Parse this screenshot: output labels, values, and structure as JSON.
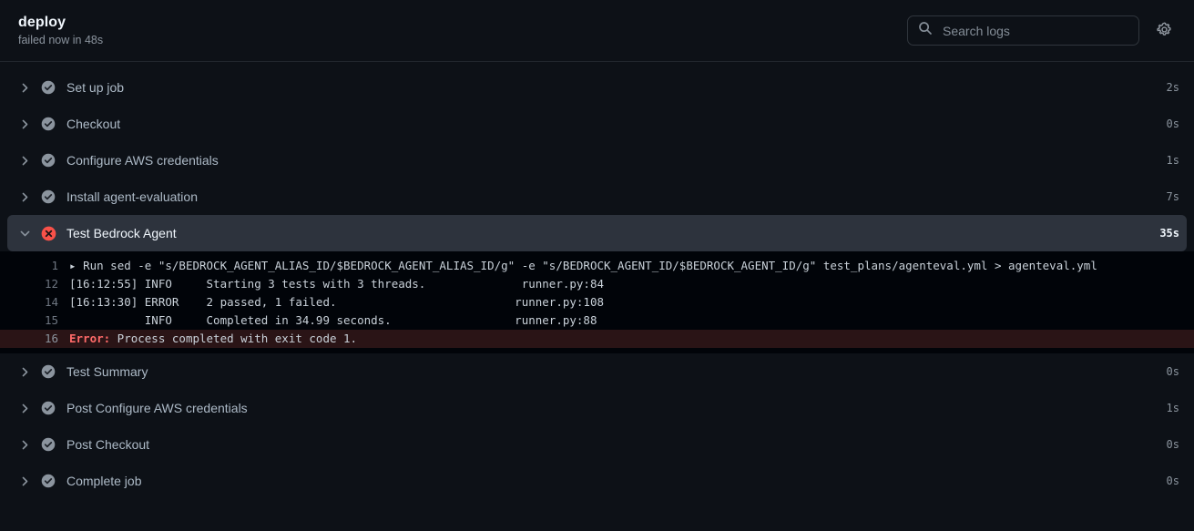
{
  "header": {
    "job_title": "deploy",
    "job_status": "failed now in 48s",
    "search": {
      "placeholder": "Search logs",
      "value": "",
      "icon": "search-icon"
    },
    "settings_icon": "gear-icon"
  },
  "colors": {
    "page_bg": "#0d1117",
    "log_bg": "#010409",
    "active_row_bg": "#2d333d",
    "error_row_bg": "#2a1416",
    "error_red": "#f85149",
    "success_gray": "#8b949e",
    "text_primary": "#c9d1d9",
    "text_muted": "#8b949e"
  },
  "steps": [
    {
      "label": "Set up job",
      "duration": "2s",
      "status": "success",
      "expanded": false,
      "chevron": "chevron-right-icon"
    },
    {
      "label": "Checkout",
      "duration": "0s",
      "status": "success",
      "expanded": false,
      "chevron": "chevron-right-icon"
    },
    {
      "label": "Configure AWS credentials",
      "duration": "1s",
      "status": "success",
      "expanded": false,
      "chevron": "chevron-right-icon"
    },
    {
      "label": "Install agent-evaluation",
      "duration": "7s",
      "status": "success",
      "expanded": false,
      "chevron": "chevron-right-icon"
    },
    {
      "label": "Test Bedrock Agent",
      "duration": "35s",
      "status": "failure",
      "expanded": true,
      "chevron": "chevron-down-icon"
    },
    {
      "label": "Test Summary",
      "duration": "0s",
      "status": "success",
      "expanded": false,
      "chevron": "chevron-right-icon"
    },
    {
      "label": "Post Configure AWS credentials",
      "duration": "1s",
      "status": "success",
      "expanded": false,
      "chevron": "chevron-right-icon"
    },
    {
      "label": "Post Checkout",
      "duration": "0s",
      "status": "success",
      "expanded": false,
      "chevron": "chevron-right-icon"
    },
    {
      "label": "Complete job",
      "duration": "0s",
      "status": "success",
      "expanded": false,
      "chevron": "chevron-right-icon"
    }
  ],
  "log": {
    "lines": [
      {
        "number": "1",
        "kind": "command",
        "caret": "▸ ",
        "text": "Run sed -e \"s/BEDROCK_AGENT_ALIAS_ID/$BEDROCK_AGENT_ALIAS_ID/g\" -e \"s/BEDROCK_AGENT_ID/$BEDROCK_AGENT_ID/g\" test_plans/agenteval.yml > agenteval.yml"
      },
      {
        "number": "12",
        "kind": "info",
        "text": "[16:12:55] INFO     Starting 3 tests with 3 threads.              runner.py:84"
      },
      {
        "number": "14",
        "kind": "error",
        "text": "[16:13:30] ERROR    2 passed, 1 failed.                          runner.py:108"
      },
      {
        "number": "15",
        "kind": "info",
        "text": "           INFO     Completed in 34.99 seconds.                  runner.py:88"
      },
      {
        "number": "16",
        "kind": "failure",
        "prefix": "Error:",
        "text": " Process completed with exit code 1."
      }
    ]
  }
}
